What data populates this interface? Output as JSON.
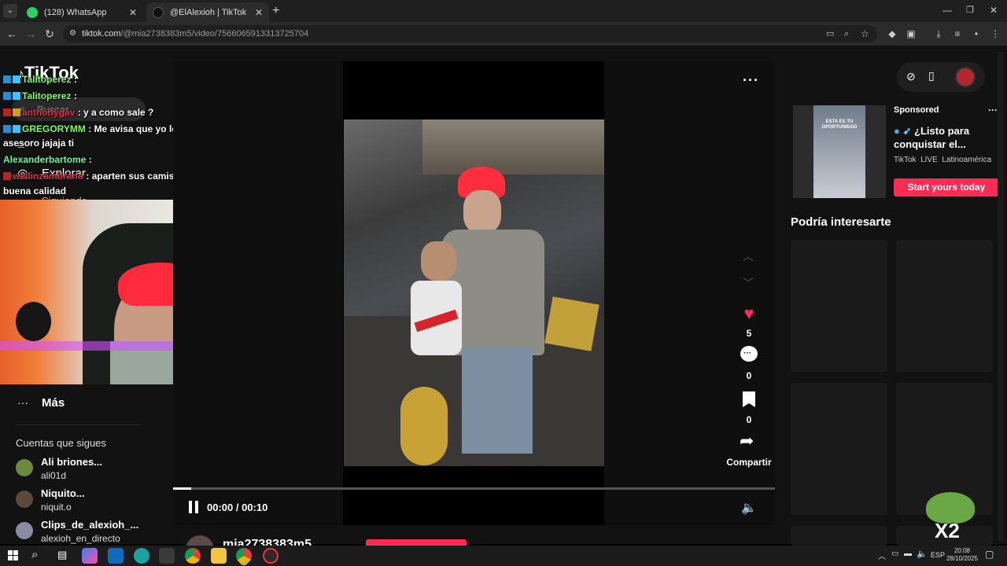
{
  "browser": {
    "tabs": [
      {
        "label": "(128) WhatsApp",
        "active": false
      },
      {
        "label": "@ElAlexioh | TikTok",
        "active": true
      }
    ],
    "url_host": "tiktok.com",
    "url_path": "/@mia2738383m5/video/7566065913313725704"
  },
  "sidebar": {
    "logo": "TikTok",
    "search_placeholder": "Buscar",
    "explore_label": "Explorar",
    "following_partial": "Siguiendo",
    "more_label": "Más",
    "following_title": "Cuentas que sigues",
    "accounts": [
      {
        "name": "Ali briones...",
        "handle": "ali01d"
      },
      {
        "name": "Niquito...",
        "handle": "niquit.o"
      },
      {
        "name": "Clips_de_alexioh_...",
        "handle": "alexioh_en_directo"
      }
    ]
  },
  "chat": [
    {
      "user": "Talitoperez",
      "text": ":"
    },
    {
      "user": "Talitoperez",
      "text": ":"
    },
    {
      "user": "anthonygav",
      "text": ": y a como sale ?"
    },
    {
      "user": "GREGORYMM",
      "text": ": Me avisa que yo lo"
    },
    {
      "user": "",
      "text": "asesoro jajaja ti"
    },
    {
      "user": "Alexanderbartome",
      "text": ":"
    },
    {
      "user": "wellinzambrano",
      "text": ": aparten sus camisa es de"
    },
    {
      "user": "",
      "text": "buena calidad"
    }
  ],
  "player": {
    "likes": "5",
    "comments": "0",
    "saves": "0",
    "share_label": "Compartir",
    "time": "00:00 / 00:10",
    "progress": 0.03,
    "author_partial": "mia2738383m5"
  },
  "ad": {
    "sponsored": "Sponsored",
    "headline": "¿Listo para conquistar el...",
    "meta_brand": "TikTok",
    "meta_live": "LIVE",
    "meta_region": "Latinoamérica",
    "cta": "Start yours today",
    "thumb_text": "ESTA ES TU OPORTUNIDAD"
  },
  "suggestions_title": "Podría interesarte",
  "overlay_badge": "X2",
  "taskbar": {
    "lang": "ESP",
    "time": "20:08",
    "date": "28/10/2025"
  },
  "colors": {
    "accent": "#fe2c55",
    "chat_user": "#7cff5c",
    "chat_user_red": "#e0304d"
  }
}
